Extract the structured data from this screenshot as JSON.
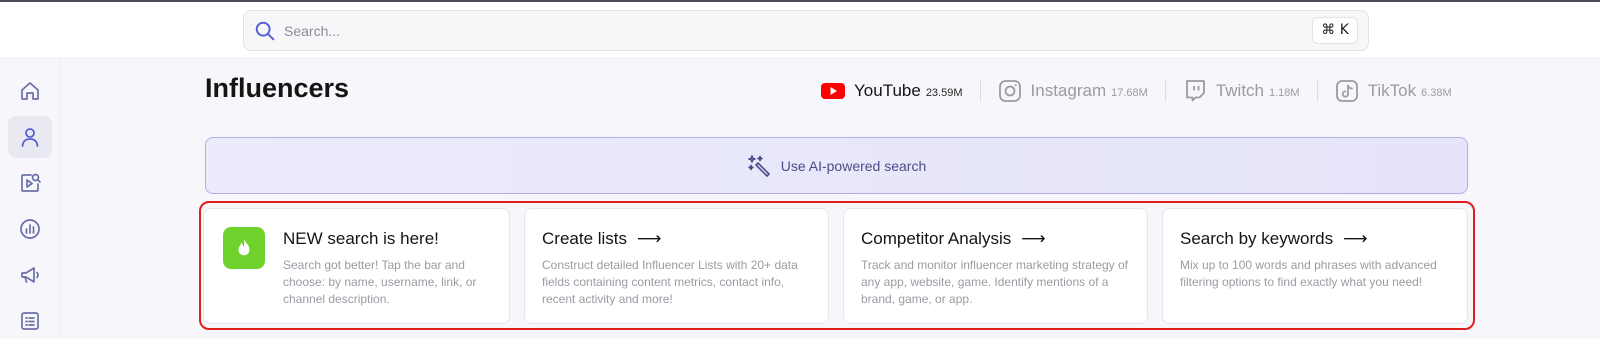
{
  "search": {
    "placeholder": "Search...",
    "shortcut": "⌘ K"
  },
  "sidebar": {
    "items": [
      {
        "name": "home"
      },
      {
        "name": "influencers",
        "active": true
      },
      {
        "name": "media"
      },
      {
        "name": "analytics"
      },
      {
        "name": "campaigns"
      },
      {
        "name": "lists"
      }
    ]
  },
  "page": {
    "title": "Influencers"
  },
  "platforms": [
    {
      "name": "YouTube",
      "count": "23.59M",
      "active": true,
      "icon": "youtube-icon"
    },
    {
      "name": "Instagram",
      "count": "17.68M",
      "active": false,
      "icon": "instagram-icon"
    },
    {
      "name": "Twitch",
      "count": "1.18M",
      "active": false,
      "icon": "twitch-icon"
    },
    {
      "name": "TikTok",
      "count": "6.38M",
      "active": false,
      "icon": "tiktok-icon"
    }
  ],
  "ai_search": {
    "label": "Use AI-powered search"
  },
  "cards": [
    {
      "title": "NEW search is here!",
      "desc": "Search got better! Tap the bar and choose: by name, username, link, or channel description.",
      "icon": "flame-icon"
    },
    {
      "title": "Create lists",
      "desc": "Construct detailed Influencer Lists with 20+ data fields containing content metrics, contact info, recent activity and more!"
    },
    {
      "title": "Competitor Analysis",
      "desc": "Track and monitor influencer marketing strategy of any app, website, game. Identify mentions of a brand, game, or app."
    },
    {
      "title": "Search by keywords",
      "desc": "Mix up to 100 words and phrases with advanced filtering options to find exactly what you need!"
    }
  ],
  "arrow": "⟶",
  "colors": {
    "accent": "#5b5fd6",
    "youtube": "#ff0000",
    "new_badge": "#6fd12c",
    "highlight": "#e21d1d"
  }
}
